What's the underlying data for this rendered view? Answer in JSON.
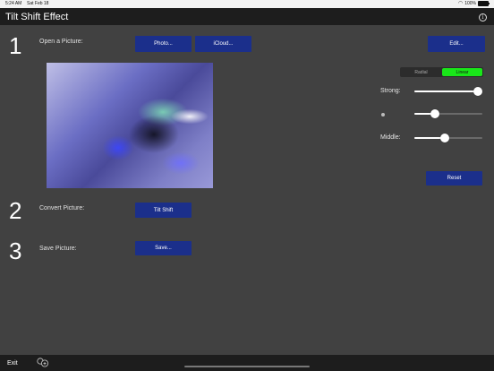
{
  "status_bar": {
    "time": "5:24 AM",
    "date": "Sat Feb 18",
    "battery_text": "100%",
    "battery_level": 1.0
  },
  "nav": {
    "title": "Tilt Shift Effect",
    "info_icon": "info-circle-icon"
  },
  "steps": [
    {
      "number": "1",
      "label": "Open a Picture:"
    },
    {
      "number": "2",
      "label": "Convert Picture:"
    },
    {
      "number": "3",
      "label": "Save Picture:"
    }
  ],
  "buttons": {
    "photo": "Photo...",
    "icloud": "iCloud...",
    "edit": "Edit...",
    "tilt_shift": "Tilt Shift",
    "save": "Save...",
    "reset": "Reset"
  },
  "segmented": {
    "options": [
      "Radial",
      "Linear"
    ],
    "selected": "Linear"
  },
  "sliders": [
    {
      "label": "Strong:",
      "value": 0.93
    },
    {
      "label": "",
      "icon": "dot-icon",
      "value": 0.3
    },
    {
      "label": "Middle:",
      "value": 0.45
    }
  ],
  "bottom": {
    "exit": "Exit",
    "icon": "translate-icon"
  },
  "colors": {
    "button": "#1b2f8b",
    "selected_segment": "#19e619",
    "background": "#414141",
    "bars": "#1d1d1d"
  }
}
